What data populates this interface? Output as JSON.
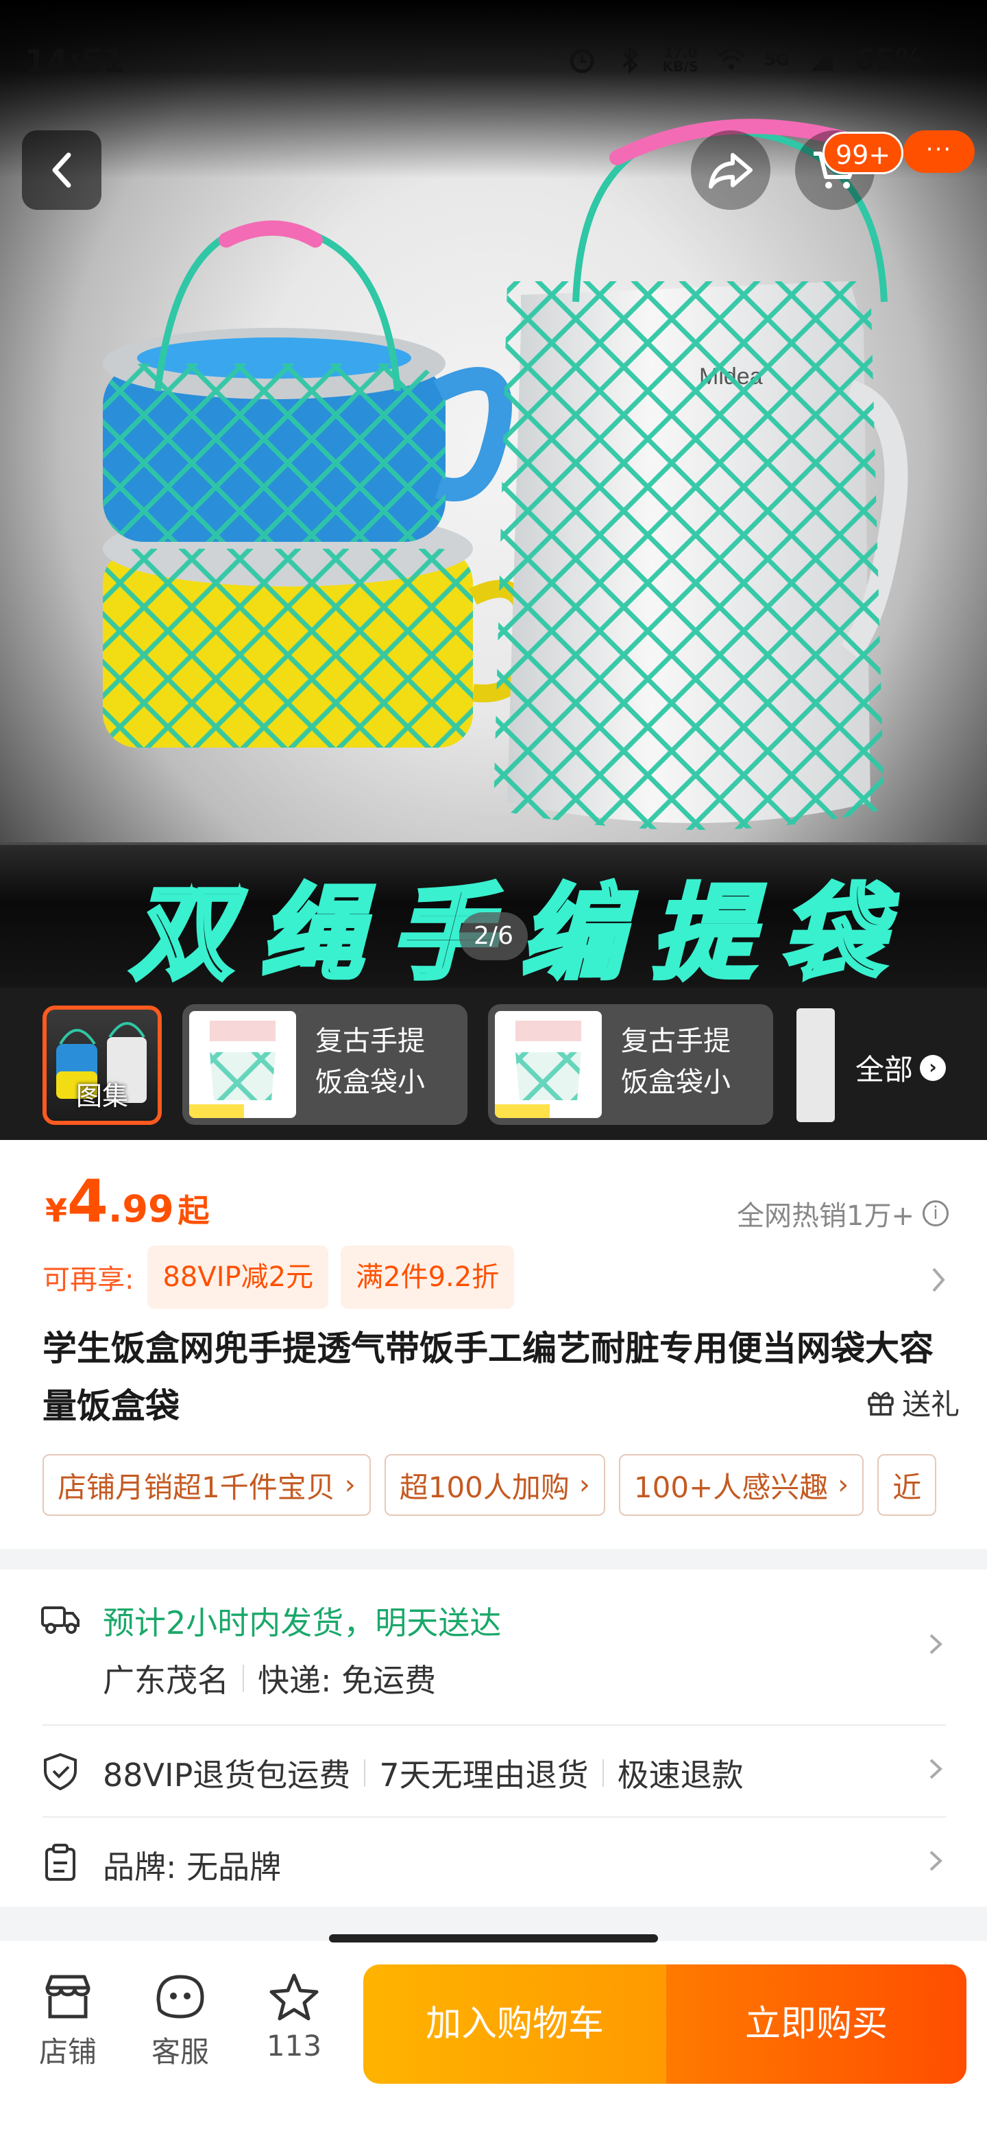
{
  "status_bar": {
    "time": "14:51",
    "net_speed_value": "17.0",
    "net_speed_unit": "KB/S",
    "network": "5G",
    "battery": "65%"
  },
  "nav": {
    "cart_badge": "99+",
    "more_dots": "···"
  },
  "gallery": {
    "banner_text": "双绳手编提袋",
    "page_indicator": "2/6",
    "thumb_main_label": "图集",
    "thumb_cards": [
      {
        "line1": "复古手提",
        "line2": "饭盒袋小"
      },
      {
        "line1": "复古手提",
        "line2": "饭盒袋小"
      }
    ],
    "all_label": "全部"
  },
  "product": {
    "price_currency": "¥",
    "price_int": "4",
    "price_dec": ".99",
    "price_suffix": "起",
    "sales": "全网热销1万+",
    "promo_lead": "可再享:",
    "promo_tags": [
      "88VIP减2元",
      "满2件9.2折"
    ],
    "title": "学生饭盒网兜手提透气带饭手工编艺耐脏专用便当网袋大容量饭盒袋",
    "gift_label": "送礼",
    "highlights": [
      "店铺月销超1千件宝贝",
      "超100人加购",
      "100+人感兴趣",
      "近"
    ]
  },
  "service": {
    "delivery_estimate": "预计2小时内发货，明天送达",
    "origin": "广东茂名",
    "express_label": "快递: 免运费",
    "returns": [
      "88VIP退货包运费",
      "7天无理由退货",
      "极速退款"
    ],
    "brand": "品牌: 无品牌"
  },
  "bottom_bar": {
    "shop_label": "店铺",
    "service_label": "客服",
    "fav_count": "113",
    "add_to_cart": "加入购物车",
    "buy_now": "立即购买"
  },
  "colors": {
    "accent": "#ff5000",
    "green": "#1aa86a",
    "cart_button": "#ffa800",
    "buy_button": "#ff5a00"
  }
}
